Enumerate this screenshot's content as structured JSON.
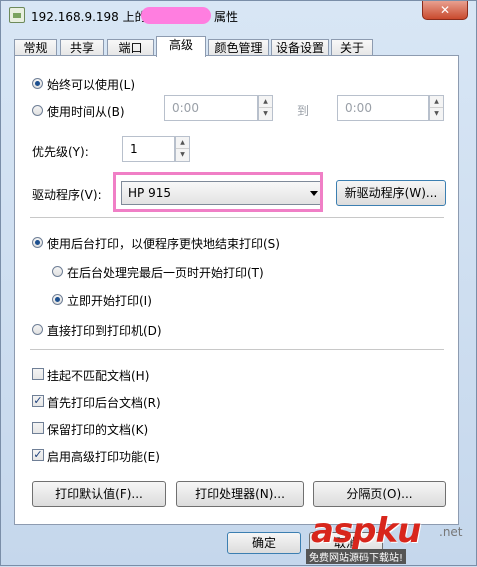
{
  "window": {
    "title_prefix": "192.168.9.198 上的",
    "title_suffix": "属性",
    "close_label": "✕"
  },
  "tabs": [
    {
      "label": "常规"
    },
    {
      "label": "共享"
    },
    {
      "label": "端口"
    },
    {
      "label": "高级"
    },
    {
      "label": "颜色管理"
    },
    {
      "label": "设备设置"
    },
    {
      "label": "关于"
    }
  ],
  "availability": {
    "always_label": "始终可以使用(L)",
    "from_label": "使用时间从(B)",
    "from_time": "0:00",
    "to_label": "到",
    "to_time": "0:00"
  },
  "priority": {
    "label": "优先级(Y):",
    "value": "1"
  },
  "driver": {
    "label": "驱动程序(V):",
    "selected": "HP 915",
    "new_driver_button": "新驱动程序(W)..."
  },
  "spooling": {
    "spool_label": "使用后台打印，以便程序更快地结束打印(S)",
    "after_last_page_label": "在后台处理完最后一页时开始打印(T)",
    "immediately_label": "立即开始打印(I)",
    "direct_label": "直接打印到打印机(D)"
  },
  "options": [
    {
      "label": "挂起不匹配文档(H)",
      "checked": false
    },
    {
      "label": "首先打印后台文档(R)",
      "checked": true
    },
    {
      "label": "保留打印的文档(K)",
      "checked": false
    },
    {
      "label": "启用高级打印功能(E)",
      "checked": true
    }
  ],
  "buttons": {
    "defaults": "打印默认值(F)...",
    "processor": "打印处理器(N)...",
    "separator": "分隔页(O)...",
    "ok": "确定",
    "cancel": "取消"
  },
  "watermark": {
    "main": "aspku",
    "net": ".net",
    "sub": "免费网站源码下载站!"
  },
  "colors": {
    "highlight": "#f07fc6",
    "title_mask": "#ff7ee0",
    "watermark_red": "#d8261c"
  }
}
